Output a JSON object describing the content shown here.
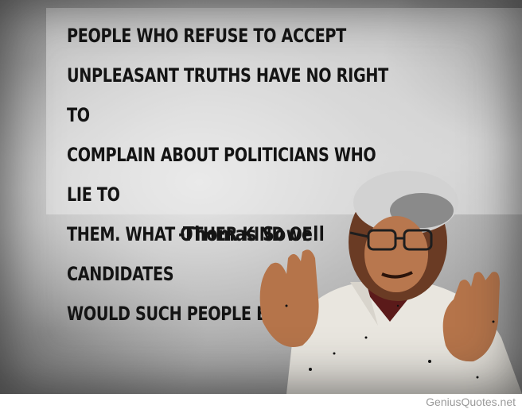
{
  "quote": {
    "lines": [
      "People who refuse to accept",
      "unpleasant truths have no right to",
      "complain about politicians who lie to",
      "them. What other kind of candidates",
      "would such people elect?"
    ],
    "author": "-Thomas Sowell"
  },
  "portrait": {
    "subject": "man-gesturing-with-glasses"
  },
  "watermark": {
    "text": "GeniusQuotes.net"
  },
  "colors": {
    "text": "#141414",
    "background": "#a8a8a8",
    "watermark": "#9a9a9a"
  }
}
